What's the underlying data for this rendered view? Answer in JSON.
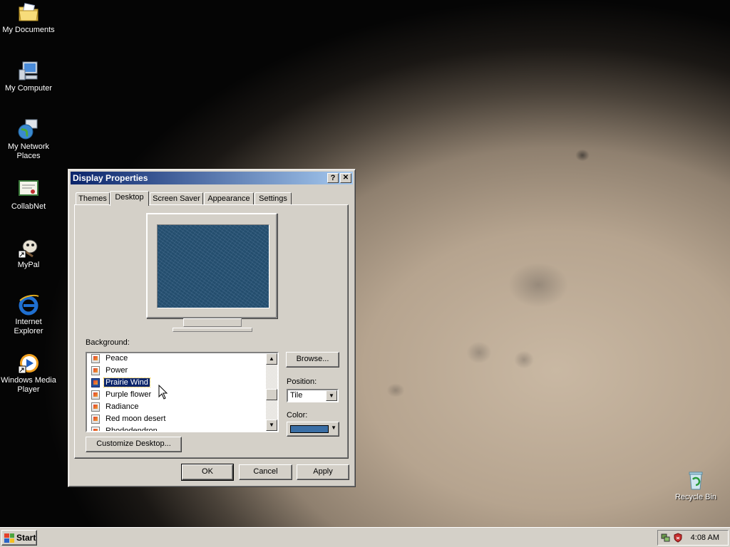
{
  "desktop": {
    "icons": [
      {
        "label": "My Documents",
        "icon": "folder-documents-icon"
      },
      {
        "label": "My Computer",
        "icon": "computer-icon"
      },
      {
        "label": "My Network Places",
        "icon": "network-globe-icon"
      },
      {
        "label": "CollabNet",
        "icon": "certificate-icon"
      },
      {
        "label": "MyPal",
        "icon": "mypal-shortcut-icon"
      },
      {
        "label": "Internet Explorer",
        "icon": "internet-explorer-icon"
      },
      {
        "label": "Windows Media Player",
        "icon": "media-player-icon"
      },
      {
        "label": "Recycle Bin",
        "icon": "recycle-bin-icon"
      }
    ]
  },
  "dialog": {
    "title": "Display Properties",
    "help_label": "?",
    "close_label": "✕",
    "tabs": [
      {
        "label": "Themes"
      },
      {
        "label": "Desktop",
        "active": true
      },
      {
        "label": "Screen Saver"
      },
      {
        "label": "Appearance"
      },
      {
        "label": "Settings"
      }
    ],
    "background_label": "Background:",
    "background_items": [
      "Peace",
      "Power",
      "Prairie Wind",
      "Purple flower",
      "Radiance",
      "Red moon desert",
      "Rhododendron"
    ],
    "selected_background": "Prairie Wind",
    "browse_label": "Browse...",
    "position_label": "Position:",
    "position_value": "Tile",
    "color_label": "Color:",
    "color_value": "#3a6ea5",
    "customize_label": "Customize Desktop...",
    "ok_label": "OK",
    "cancel_label": "Cancel",
    "apply_label": "Apply"
  },
  "taskbar": {
    "start_label": "Start",
    "clock": "4:08 AM"
  },
  "colors": {
    "title_active": "#0a246a",
    "face": "#d4d0c8",
    "selection": "#0a246a"
  }
}
